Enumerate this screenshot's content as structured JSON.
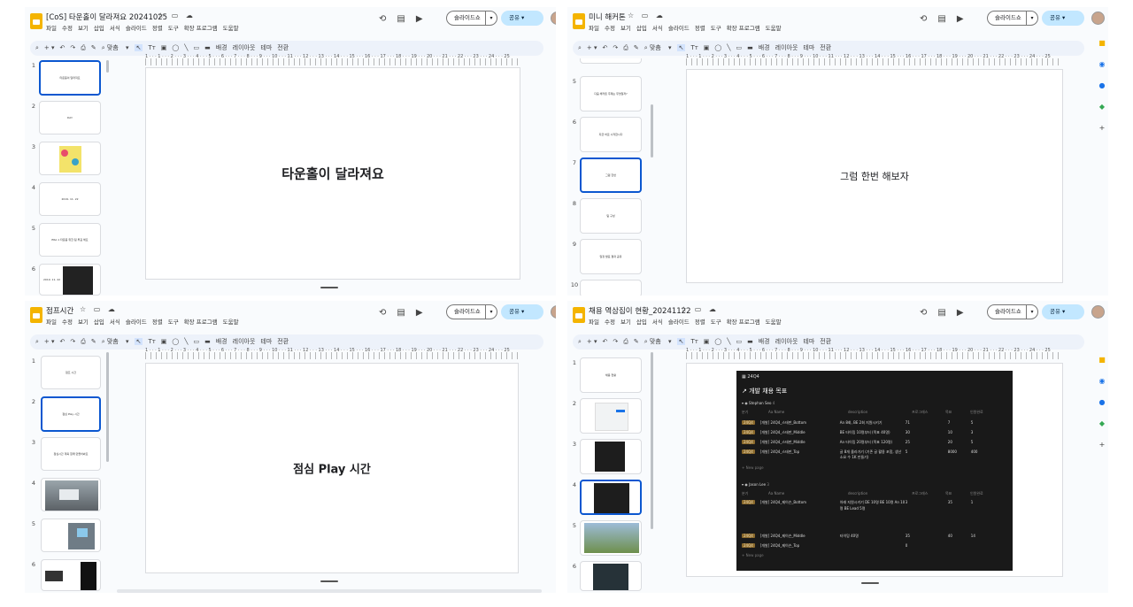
{
  "menu": [
    "파일",
    "수정",
    "보기",
    "삽입",
    "서식",
    "슬라이드",
    "정렬",
    "도구",
    "확장 프로그램",
    "도움말"
  ],
  "toolbar": {
    "zoom": "맞춤",
    "bg": "배경",
    "layout": "레이아웃",
    "theme": "테마",
    "transition": "전환"
  },
  "slideshow_label": "슬라이드쇼",
  "share_label": "공유",
  "ruler_numbers": "1 · · · 1 · · · 2 · · · 3 · · · 4 · · · 5 · · · 6 · · · 7 · · · 8 · · · 9 · · · 10 · · · 11 · · · 12 · · · 13 · · · 14 · · · 15 · · · 16 · · · 17 · · · 18 · · · 19 · · · 20 · · · 21 · · · 22 · · · 23 · · · 24 · · · 25",
  "windows": [
    {
      "title": "[CoS] 타운홀이 달라져요 20241025",
      "main_text": "타운홀이 달라져요",
      "slides": [
        {
          "n": "1",
          "t": "타운홀이 달라져요"
        },
        {
          "n": "2",
          "t": "DAY"
        },
        {
          "n": "3",
          "t": ""
        },
        {
          "n": "4",
          "t": "2019. 11. 22"
        },
        {
          "n": "5",
          "t": "ERA 1 타운홀 위한 팀 투표 해요"
        },
        {
          "n": "6",
          "t": "2019. 11. 22"
        }
      ]
    },
    {
      "title": "미니 해커톤",
      "main_text": "그럼 한번 해보자",
      "slides": [
        {
          "n": "5",
          "t": "다음 해커톤 주제는 무엇일까?"
        },
        {
          "n": "6",
          "t": "지금 바로 시작합시다"
        },
        {
          "n": "7",
          "t": "그럼 한번"
        },
        {
          "n": "8",
          "t": "팀 구성"
        },
        {
          "n": "9",
          "t": "일정 발표 결과 공유"
        },
        {
          "n": "10",
          "t": ""
        }
      ]
    },
    {
      "title": "점프시간",
      "main_text": "점심 Play 시간",
      "slides": [
        {
          "n": "1",
          "t": "점프 시간"
        },
        {
          "n": "2",
          "t": "점심 Play 시간"
        },
        {
          "n": "3",
          "t": "점심시간 계획 함께 만들어봐요"
        },
        {
          "n": "4",
          "t": ""
        },
        {
          "n": "5",
          "t": ""
        },
        {
          "n": "6",
          "t": ""
        }
      ]
    },
    {
      "title": "채용 역삼집이 현황_20241122",
      "main_text": "",
      "slides": [
        {
          "n": "1",
          "t": "채용 현황"
        },
        {
          "n": "2",
          "t": ""
        },
        {
          "n": "3",
          "t": ""
        },
        {
          "n": "4",
          "t": ""
        },
        {
          "n": "5",
          "t": ""
        },
        {
          "n": "6",
          "t": ""
        }
      ]
    }
  ],
  "notion": {
    "header": "24Q4",
    "title": "↗ 개발 채용 목표",
    "groups": [
      {
        "owner": "Stephan Seo",
        "count": "4",
        "cols": [
          "분기",
          "Aa Name",
          "description",
          "프로그래스",
          "목표",
          "인원완료"
        ],
        "rows": [
          {
            "tag": "24Q4",
            "name": "[개발] 24Q4_스태판_Bottom",
            "desc": "An 8회, BE 2회 지원시키기",
            "p": "71",
            "goal": "7",
            "done": "5"
          },
          {
            "tag": "24Q4",
            "name": "[개발] 24Q4_스태판_Middle",
            "desc": "BE 타이밍 10명부터 (목표 40명)",
            "p": "30",
            "goal": "10",
            "done": "3"
          },
          {
            "tag": "24Q4",
            "name": "[개발] 24Q4_스태판_Middle",
            "desc": "An 타이밍 20명부터 (목표 120명)",
            "p": "25",
            "goal": "20",
            "done": "5"
          },
          {
            "tag": "24Q4",
            "name": "[개발] 24Q4_스태판_Top",
            "desc": "글 8개 올라가기 (기존 글 활용 포함, 생산 소요 수 1K 만들기)",
            "p": "5",
            "goal": "8000",
            "done": "400"
          }
        ]
      },
      {
        "owner": "Jason Lee",
        "count": "3",
        "cols": [
          "분기",
          "Aa Name",
          "description",
          "프로그래스",
          "목표",
          "인원완료"
        ],
        "rows": [
          {
            "tag": "24Q4",
            "name": "[개발] 24Q4_제이슨_Bottom",
            "desc": "아래 지원시키기 DE 10명 BE 10명 An 10명 BE Lead 5명",
            "p": "3",
            "goal": "35",
            "done": "1"
          },
          {
            "tag": "24Q4",
            "name": "[개발] 24Q4_제이슨_Middle",
            "desc": "타이밍 40명",
            "p": "35",
            "goal": "40",
            "done": "14"
          },
          {
            "tag": "24Q4",
            "name": "[개발] 24Q4_제이슨_Top",
            "desc": "",
            "p": "0",
            "goal": "",
            "done": ""
          }
        ]
      }
    ],
    "new_page": "+ New page"
  }
}
